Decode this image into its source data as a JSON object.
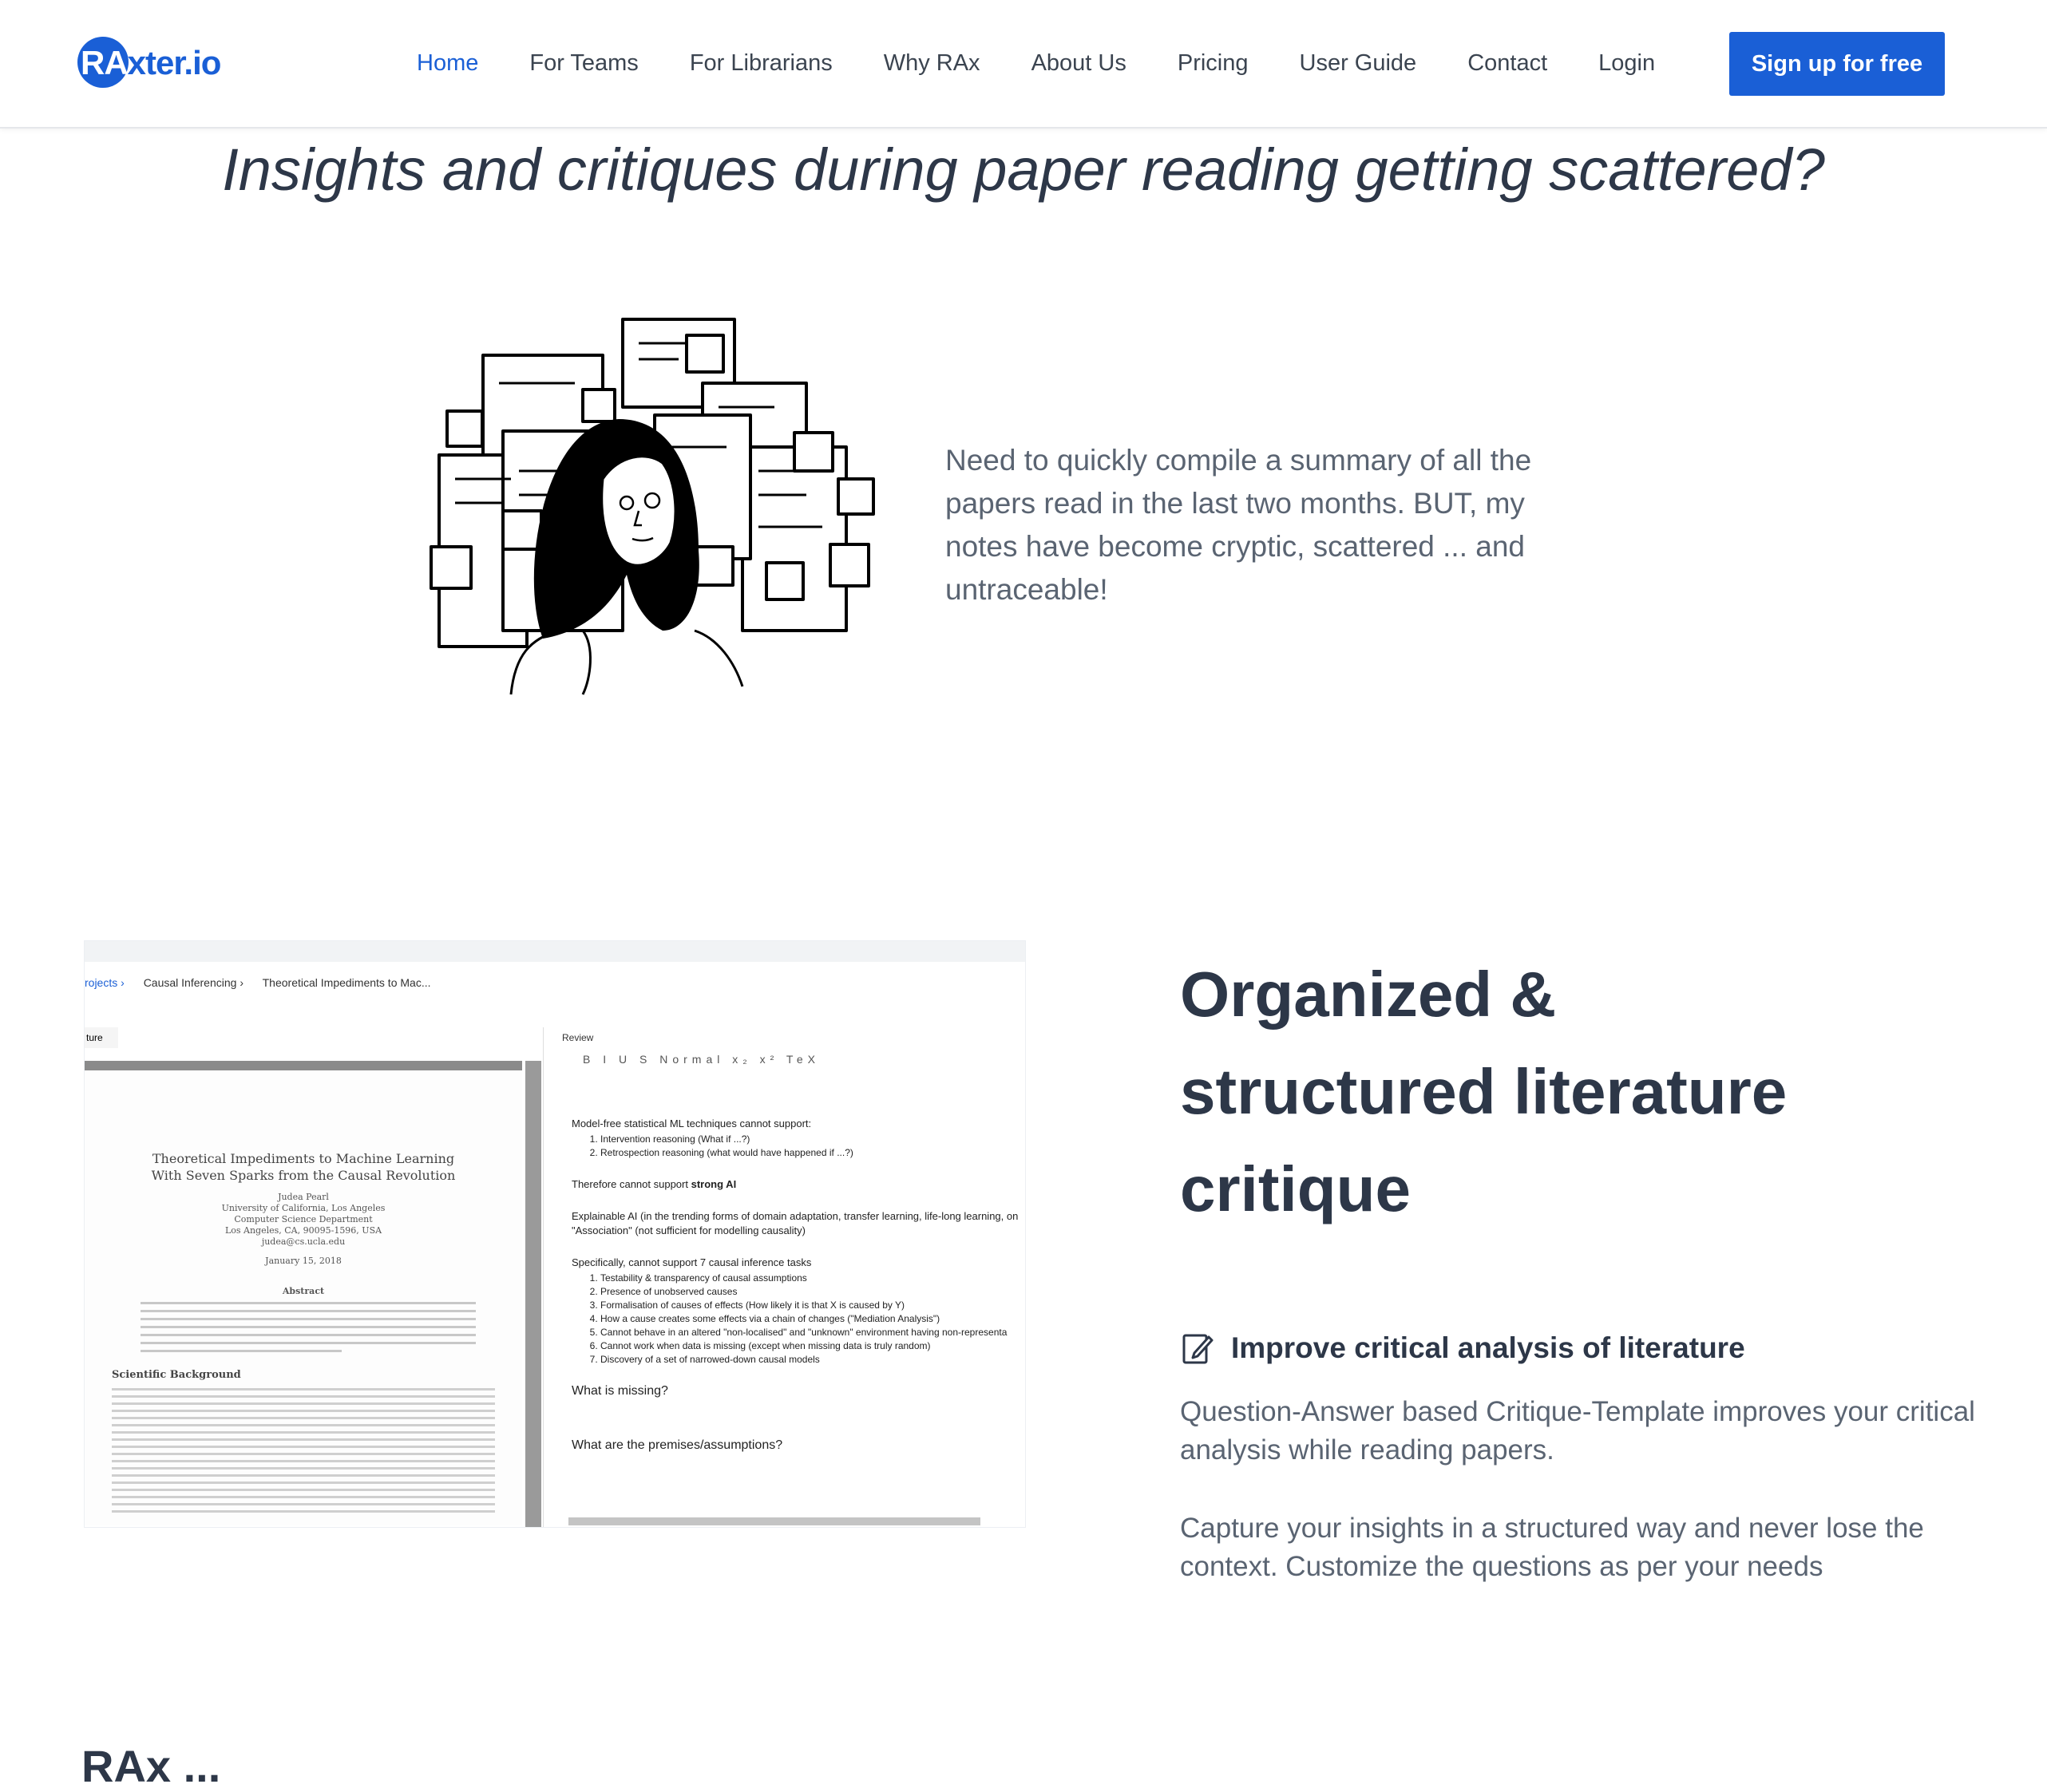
{
  "nav": {
    "logo": "RAxter.io",
    "logo_prefix": "RA",
    "logo_suffix": "xter.io",
    "items": [
      "Home",
      "For Teams",
      "For Librarians",
      "Why RAx",
      "About Us",
      "Pricing",
      "User Guide",
      "Contact",
      "Login"
    ],
    "cta": "Sign up for free"
  },
  "colors": {
    "accent": "#1a5fd6",
    "heading": "#2d3748",
    "body": "#5a6472"
  },
  "hero": {
    "tagline": "Insights and critiques during paper reading getting scattered?",
    "description": "Need to quickly compile a summary of all the papers read in the last two months. BUT, my notes have become cryptic, scattered ... and untraceable!"
  },
  "screenshot": {
    "breadcrumbs": [
      "rojects ›",
      "Causal Inferencing ›",
      "Theoretical Impediments to Mac..."
    ],
    "left_tab": "ture",
    "right_tab": "Review",
    "toolbar": "B I U S   Normal   x₂ x²   TeX",
    "paper_title": "Theoretical Impediments to Machine Learning\nWith Seven Sparks from the Causal Revolution",
    "paper_author": "Judea Pearl\nUniversity of California, Los Angeles\nComputer Science Department\nLos Angeles, CA, 90095-1596, USA\njudea@cs.ucla.edu",
    "paper_date": "January 15, 2018",
    "paper_abstract_heading": "Abstract",
    "paper_section": "Scientific Background",
    "review": {
      "intro": "Model-free statistical ML techniques cannot support:",
      "list1": [
        "Intervention reasoning (What if ...?)",
        "Retrospection reasoning (what would have happened if ...?)"
      ],
      "therefore": "Therefore cannot support",
      "strong_ai": "strong AI",
      "explainable": "Explainable AI (in the trending forms of domain adaptation, transfer learning, life-long learning, on \"Association\" (not sufficient for modelling causality)",
      "specifically": "Specifically, cannot support 7 causal inference tasks",
      "list2": [
        "Testability & transparency of causal assumptions",
        "Presence of unobserved causes",
        "Formalisation of causes of effects (How likely it is that X is caused by Y)",
        "How a cause creates some effects via a chain of changes (\"Mediation Analysis\")",
        "Cannot behave in an altered \"non-localised\" and \"unknown\" environment having non-representa",
        "Cannot work when data is missing (except when missing data is truly random)",
        "Discovery of a set of narrowed-down causal models"
      ],
      "q1": "What is missing?",
      "q2": "What are the premises/assumptions?"
    }
  },
  "feature": {
    "heading": "Organized & structured literature critique",
    "icon": "edit-icon",
    "title": "Improve critical analysis of literature",
    "para1": "Question-Answer based Critique-Template improves your critical analysis while reading papers.",
    "para2": "Capture your insights in a structured way and never lose the context. Customize the questions as per your needs"
  },
  "next_section_heading": "RAx ..."
}
